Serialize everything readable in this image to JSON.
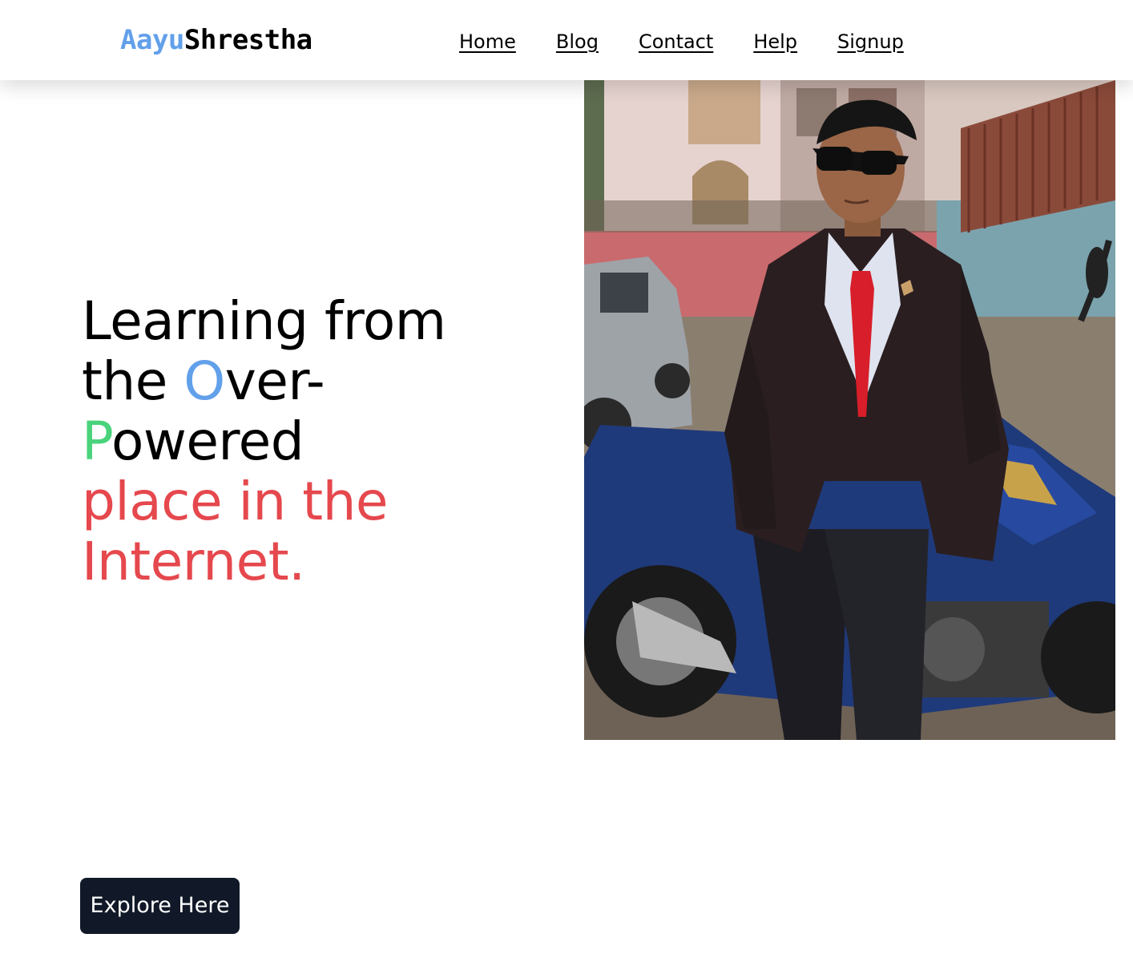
{
  "brand": {
    "first": "Aayu",
    "last": "Shrestha"
  },
  "nav": {
    "items": [
      {
        "label": "Home"
      },
      {
        "label": "Blog"
      },
      {
        "label": "Contact"
      },
      {
        "label": "Help"
      },
      {
        "label": "Signup"
      }
    ]
  },
  "hero": {
    "line1": "Learning from",
    "line2_pre": "the ",
    "line2_accent": "O",
    "line2_post": "ver-",
    "line3_accent": "P",
    "line3_post": "owered",
    "line4": "place in the",
    "line5": "Internet."
  },
  "cta": {
    "label": "Explore Here"
  },
  "colors": {
    "brand_accent": "#62a0ea",
    "accent_blue": "#62a0ea",
    "accent_green": "#4ad37b",
    "accent_red": "#e5484d",
    "button_bg": "#111827"
  },
  "icons": {
    "profile_photo": "person-on-motorcycle-photo"
  }
}
